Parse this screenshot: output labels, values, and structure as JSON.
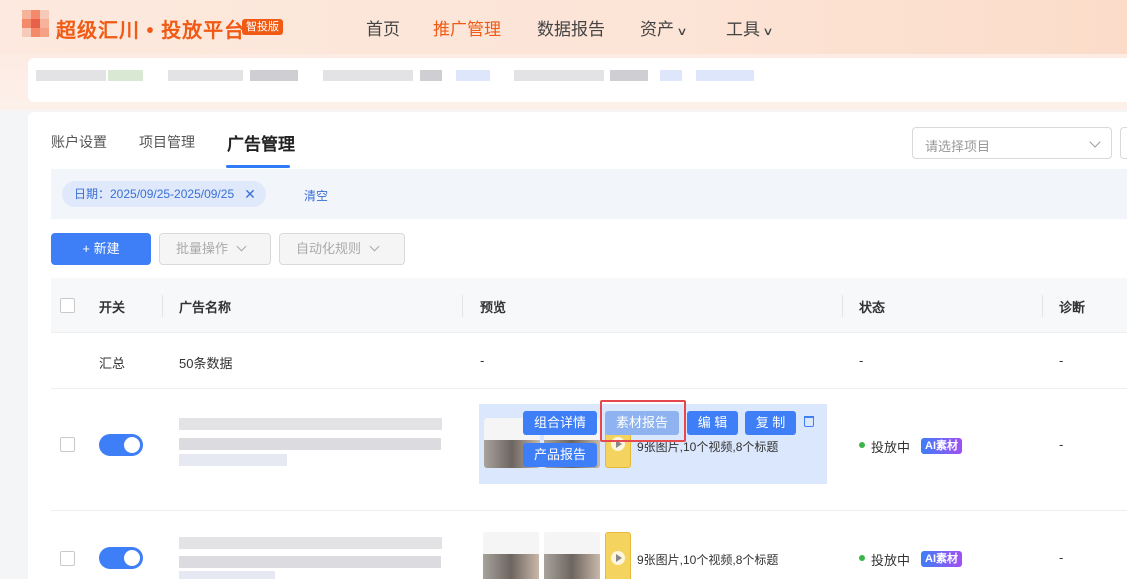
{
  "header": {
    "brand": "超级汇川 • 投放平台",
    "badge": "智投版",
    "nav": [
      {
        "label": "首页"
      },
      {
        "label": "推广管理"
      },
      {
        "label": "数据报告"
      },
      {
        "label": "资产"
      },
      {
        "label": "工具"
      }
    ],
    "active_nav": "推广管理",
    "accent_color": "#f05a14"
  },
  "subtabs": [
    {
      "label": "账户设置"
    },
    {
      "label": "项目管理"
    },
    {
      "label": "广告管理"
    }
  ],
  "active_subtab": "广告管理",
  "project_select": {
    "placeholder": "请选择项目"
  },
  "filters": {
    "date_chip": "日期：2025/09/25-2025/09/25",
    "clear": "清空"
  },
  "toolbar": {
    "new_button": "+ 新建",
    "batch_button": "批量操作",
    "auto_rule_button": "自动化规则"
  },
  "table": {
    "columns": [
      "开关",
      "广告名称",
      "预览",
      "状态",
      "诊断"
    ],
    "summary_row": {
      "label": "汇总",
      "name": "50条数据",
      "preview": "-",
      "status": "-",
      "diagnosis": "-"
    },
    "rows": [
      {
        "actions": {
          "combo": "组合详情",
          "material": "素材报告",
          "edit": "编 辑",
          "copy": "复 制",
          "product": "产品报告"
        },
        "preview_summary": "9张图片,10个视频,8个标题",
        "status": "投放中",
        "ai_badge": "AI素材",
        "diagnosis": "-"
      },
      {
        "preview_summary": "9张图片,10个视频,8个标题",
        "status": "投放中",
        "ai_badge": "AI素材",
        "diagnosis": "-"
      }
    ]
  },
  "colors": {
    "primary": "#3e7ef7",
    "status_green": "#3bb54a",
    "highlight": "#e5484d"
  }
}
